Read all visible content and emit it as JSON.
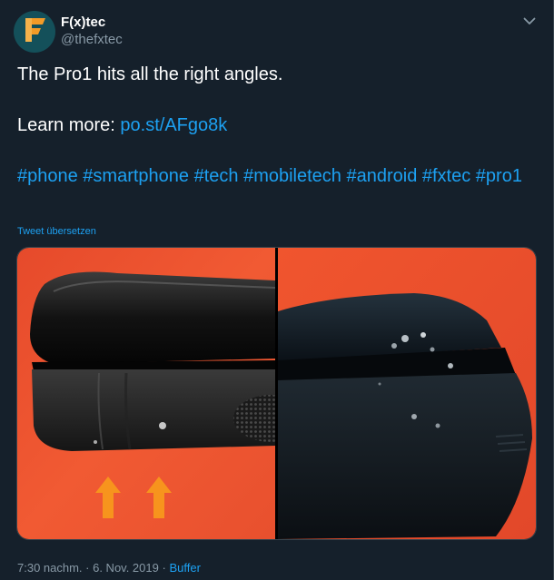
{
  "tweet": {
    "author": {
      "display_name": "F(x)tec",
      "handle": "@thefxtec",
      "avatar_icon": "fxtec-logo-icon"
    },
    "menu_icon": "chevron-down-icon",
    "text_line_1": "The Pro1 hits all the right angles.",
    "learn_more_label": "Learn more:",
    "learn_more_link": "po.st/AFgo8k",
    "hashtags": "#phone #smartphone #tech #mobiletech #android #fxtec #pro1",
    "translate_label": "Tweet übersetzen",
    "timestamp": "7:30 nachm. · 6. Nov. 2019",
    "separator": "·",
    "source": "Buffer"
  },
  "media": {
    "images": [
      {
        "description_icon": "phone-edge-photo-with-arrows"
      },
      {
        "description_icon": "phone-corner-damage-photo"
      }
    ]
  },
  "colors": {
    "background": "#15202b",
    "text": "#ffffff",
    "muted": "#8899a6",
    "link": "#1da1f2",
    "avatar_bg": "#14505a",
    "logo_orange": "#f39b27",
    "arrow_orange": "#f7941d"
  }
}
